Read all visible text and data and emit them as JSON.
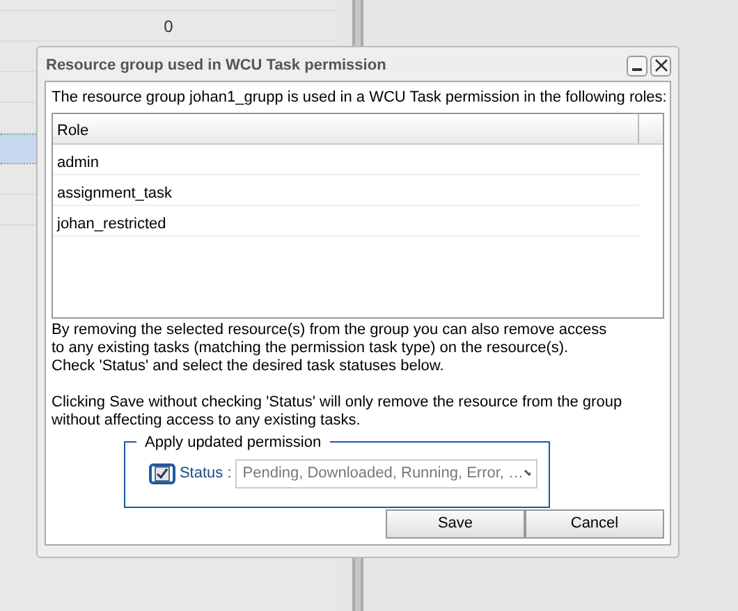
{
  "background_grid": {
    "rows": [
      {
        "value": "0",
        "selected": false
      },
      {
        "selected": false
      },
      {
        "selected": false
      },
      {
        "selected": false
      },
      {
        "selected": true
      },
      {
        "selected": false
      },
      {
        "selected": false
      }
    ]
  },
  "dialog": {
    "title": "Resource group used in WCU Task permission",
    "intro": "The resource group johan1_grupp is used in a WCU Task permission in the following roles:",
    "table": {
      "columns": [
        "Role"
      ],
      "rows": [
        "admin",
        "assignment_task",
        "johan_restricted"
      ]
    },
    "description": [
      "By removing the selected resource(s) from the group you can also remove access",
      "to any existing tasks (matching the permission task type) on the resource(s).",
      "Check 'Status' and select the desired task statuses below.",
      "Clicking Save without checking 'Status' will only remove the resource from the group",
      "without affecting access to any existing tasks."
    ],
    "fieldset": {
      "legend": "Apply updated permission",
      "status_label": "Status :",
      "status_checked": true,
      "status_value": "Pending, Downloaded, Running, Error, …"
    },
    "buttons": [
      "Save",
      "Cancel"
    ]
  }
}
